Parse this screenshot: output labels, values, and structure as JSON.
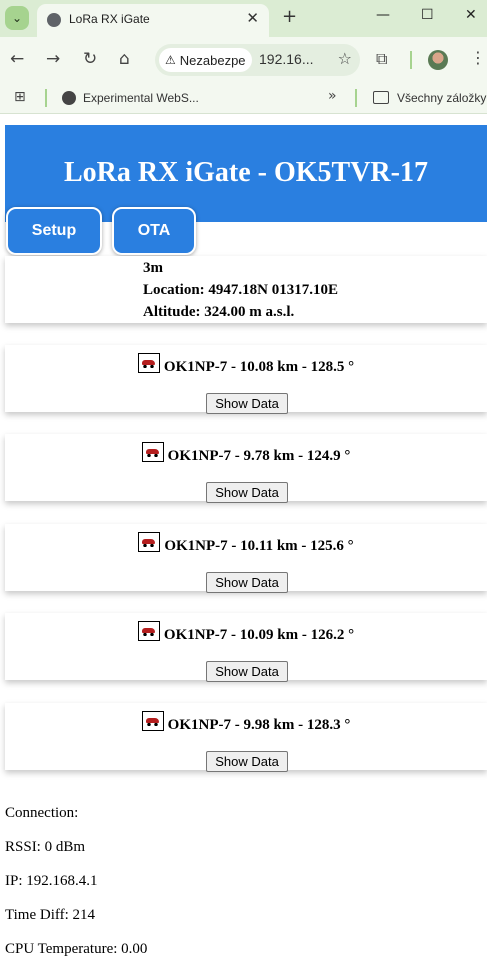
{
  "browser": {
    "tab_title": "LoRa RX iGate",
    "security_label": "Nezabezpe",
    "url": "192.16...",
    "bookmark_label": "Experimental WebS...",
    "all_bookmarks_label": "Všechny záložky"
  },
  "header": {
    "title": "LoRa RX iGate - OK5TVR-17",
    "setup_label": "Setup",
    "ota_label": "OTA"
  },
  "info": {
    "line1": "3m",
    "location": "Location: 4947.18N 01317.10E",
    "altitude": "Altitude:  324.00 m a.s.l."
  },
  "stations": [
    {
      "text": "OK1NP-7 - 10.08 km - 128.5 °",
      "button": "Show Data",
      "icon": "car-icon"
    },
    {
      "text": "OK1NP-7 - 9.78 km - 124.9 °",
      "button": "Show Data",
      "icon": "car-icon"
    },
    {
      "text": "OK1NP-7 - 10.11 km - 125.6 °",
      "button": "Show Data",
      "icon": "car-icon"
    },
    {
      "text": "OK1NP-7 - 10.09 km - 126.2 °",
      "button": "Show Data",
      "icon": "car-icon"
    },
    {
      "text": "OK1NP-7 - 9.98 km - 128.3 °",
      "button": "Show Data",
      "icon": "car-icon"
    }
  ],
  "status": {
    "connection": "Connection:",
    "rssi": "RSSI: 0 dBm",
    "ip": "IP: 192.168.4.1",
    "time_diff": "Time Diff: 214",
    "cpu_temp": "CPU Temperature: 0.00"
  },
  "colors": {
    "header_blue": "#2a7fe0",
    "chrome_green": "#dbecd3"
  }
}
